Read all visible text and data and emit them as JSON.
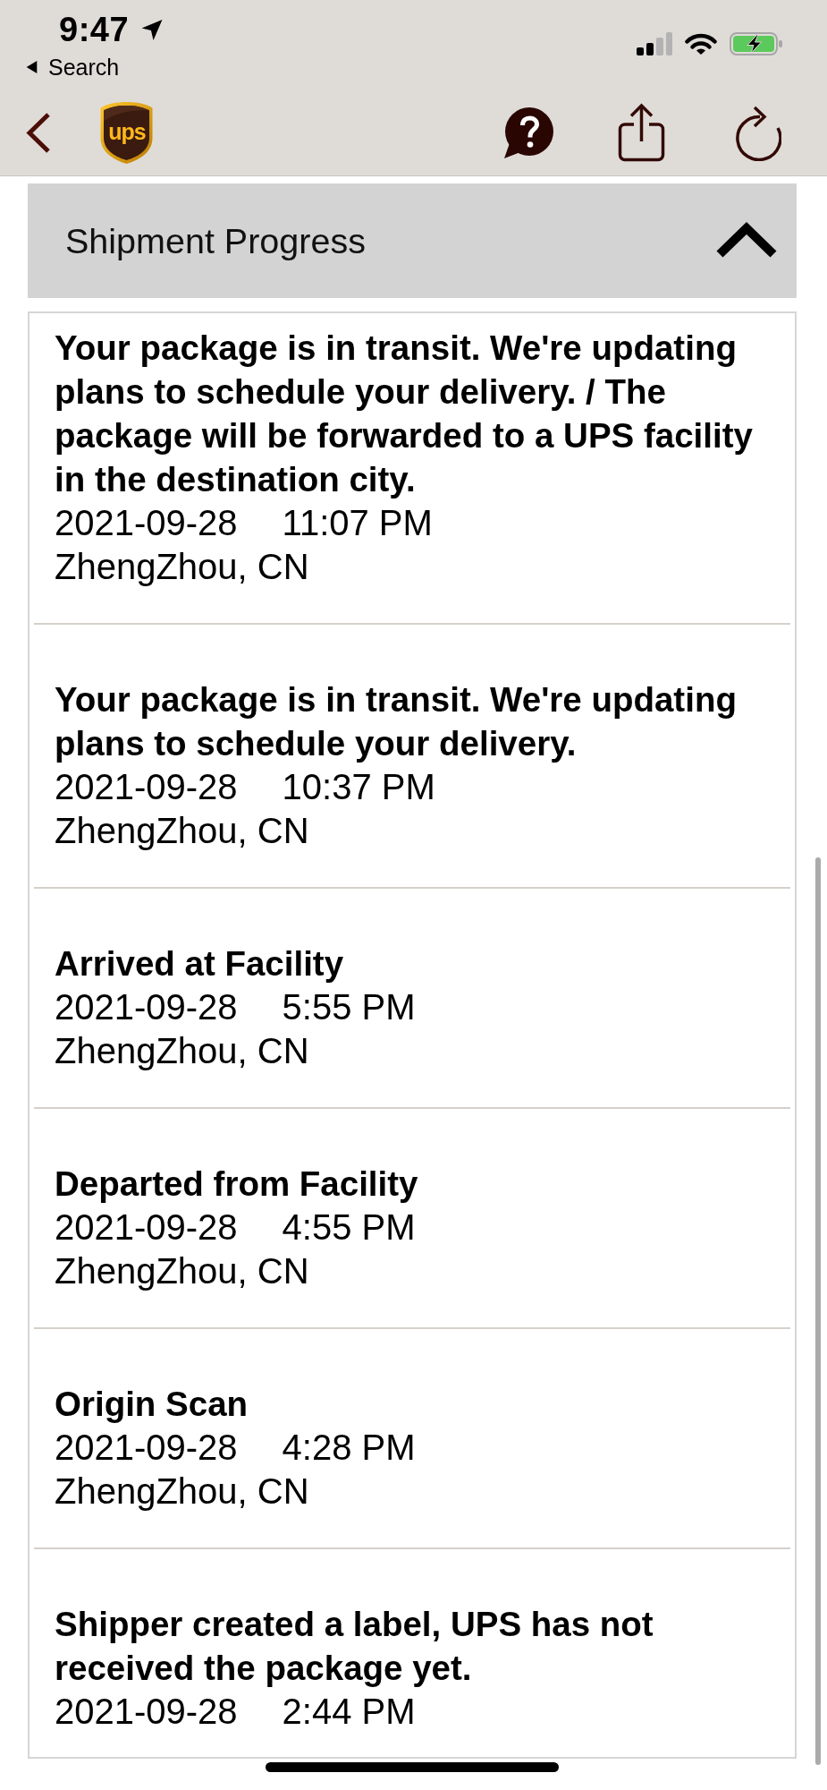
{
  "status_bar": {
    "time": "9:47",
    "back_link": "Search"
  },
  "nav_bar": {
    "logo_text": "ups"
  },
  "section": {
    "title": "Shipment Progress",
    "expanded": true
  },
  "events": [
    {
      "description": "Your package is in transit. We're updating plans to schedule your delivery. / The package will be forwarded to a UPS facility in the destination city.",
      "date": "2021-09-28",
      "time": "11:07 PM",
      "location": "ZhengZhou, CN"
    },
    {
      "description": "Your package is in transit. We're updating plans to schedule your delivery.",
      "date": "2021-09-28",
      "time": "10:37 PM",
      "location": "ZhengZhou, CN"
    },
    {
      "description": "Arrived at Facility",
      "date": "2021-09-28",
      "time": "5:55 PM",
      "location": "ZhengZhou, CN"
    },
    {
      "description": "Departed from Facility",
      "date": "2021-09-28",
      "time": "4:55 PM",
      "location": "ZhengZhou, CN"
    },
    {
      "description": "Origin Scan",
      "date": "2021-09-28",
      "time": "4:28 PM",
      "location": "ZhengZhou, CN"
    },
    {
      "description": "Shipper created a label, UPS has not received the package yet.",
      "date": "2021-09-28",
      "time": "2:44 PM"
    }
  ]
}
